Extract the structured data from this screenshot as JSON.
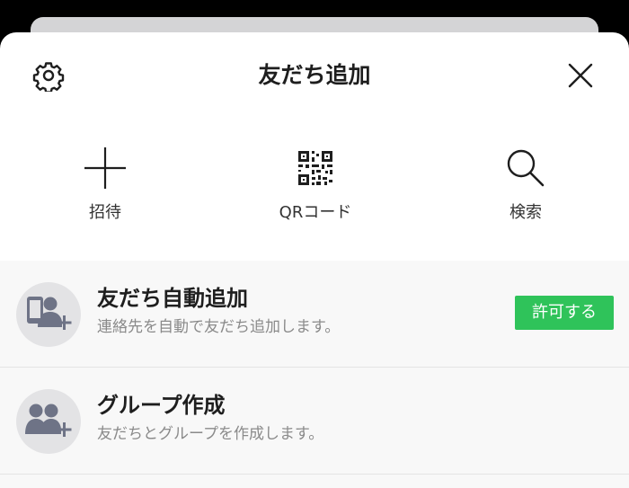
{
  "header": {
    "title": "友だち追加",
    "settings_icon": "gear-icon",
    "close_icon": "close-icon"
  },
  "actions": [
    {
      "label": "招待",
      "icon": "plus-icon"
    },
    {
      "label": "QRコード",
      "icon": "qr-code-icon"
    },
    {
      "label": "検索",
      "icon": "search-icon"
    }
  ],
  "rows": [
    {
      "title": "友だち自動追加",
      "subtitle": "連絡先を自動で友だち追加します。",
      "icon": "phone-user-add-icon",
      "button_label": "許可する"
    },
    {
      "title": "グループ作成",
      "subtitle": "友だちとグループを作成します。",
      "icon": "group-add-icon"
    }
  ],
  "colors": {
    "accent_green": "#2fc35a",
    "icon_gray": "#6e7386",
    "text_dark": "#1e1e1e",
    "text_sub": "#8a8a8a"
  }
}
